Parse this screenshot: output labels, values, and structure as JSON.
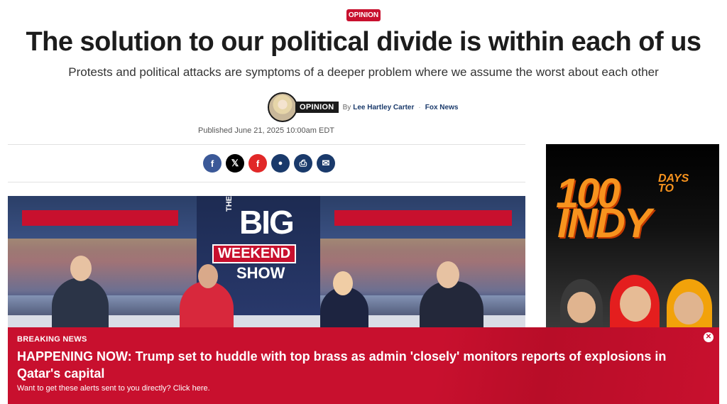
{
  "article": {
    "section_badge": "OPINION",
    "headline": "The solution to our political divide is within each of us",
    "subhead": "Protests and political attacks are symptoms of a deeper problem where we assume the worst about each other",
    "byline": {
      "opinion_tag": "OPINION",
      "by_label": "By",
      "author": "Lee Hartley Carter",
      "separator": "·",
      "outlet": "Fox News"
    },
    "published": "Published June 21, 2025 10:00am EDT"
  },
  "share": {
    "buttons": [
      {
        "name": "facebook",
        "glyph": "f",
        "color": "#3b5998"
      },
      {
        "name": "x",
        "glyph": "𝕏",
        "color": "#000000"
      },
      {
        "name": "flipboard",
        "glyph": "f",
        "color": "#e12828"
      },
      {
        "name": "comments",
        "glyph": "💬",
        "color": "#1a3a6b"
      },
      {
        "name": "print",
        "glyph": "⎙",
        "color": "#1a3a6b"
      },
      {
        "name": "email",
        "glyph": "✉",
        "color": "#1a3a6b"
      }
    ]
  },
  "hero_image": {
    "show_the": "THE",
    "show_big": "BIG",
    "show_weekend": "WEEKEND",
    "show_show": "SHOW"
  },
  "ad": {
    "line1": "100",
    "days_to": "DAYS\nTO",
    "line2": "INDY"
  },
  "breaking_news": {
    "label": "BREAKING NEWS",
    "headline": "HAPPENING NOW: Trump set to huddle with top brass as admin 'closely' monitors reports of explosions in Qatar's capital",
    "cta": "Want to get these alerts sent to you directly? Click here.",
    "close_glyph": "✕"
  },
  "colors": {
    "accent_red": "#c8102e",
    "navy": "#1a3a6b"
  }
}
